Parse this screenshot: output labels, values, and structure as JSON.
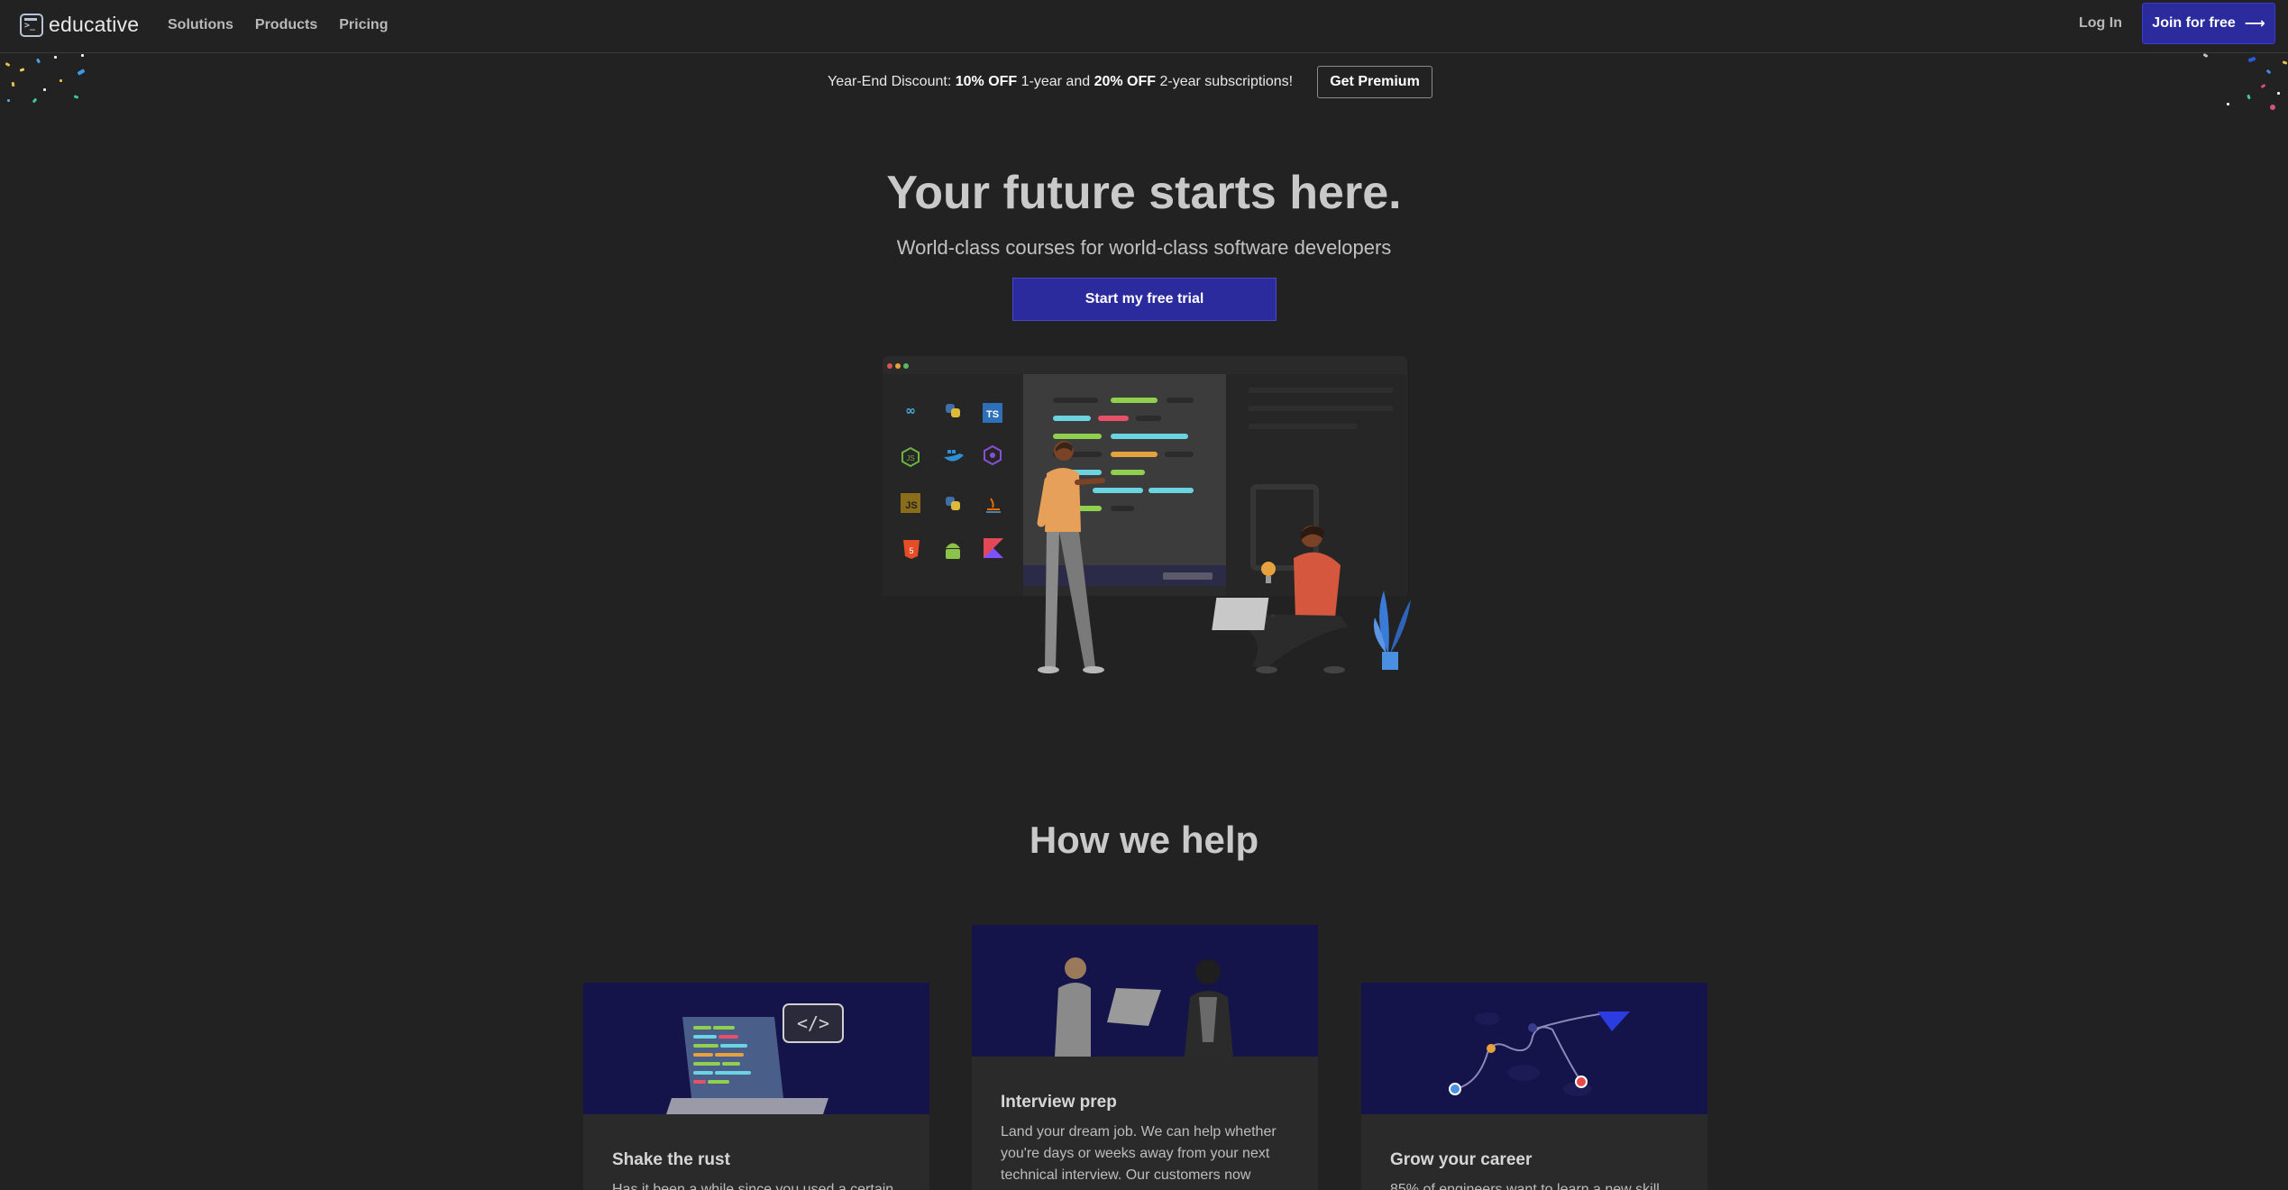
{
  "nav": {
    "logo_text": "educative",
    "links": [
      "Solutions",
      "Products",
      "Pricing"
    ],
    "login_label": "Log In",
    "join_label": "Join for free",
    "join_arrow": "⟶"
  },
  "promo": {
    "prefix": "Year-End Discount: ",
    "bold1": "10% OFF",
    "mid1": " 1-year and ",
    "bold2": "20% OFF",
    "suffix": " 2-year subscriptions!",
    "button_label": "Get Premium"
  },
  "hero": {
    "title": "Your future starts here.",
    "subtitle": "World-class courses for world-class software developers",
    "cta_label": "Start my free trial",
    "icon_labels": {
      "ts": "TS",
      "js": "JS"
    }
  },
  "how": {
    "title": "How we help",
    "cards": [
      {
        "title": "Shake the rust",
        "desc": "Has it been a while since you used a certain"
      },
      {
        "title": "Interview prep",
        "desc": "Land your dream job. We can help whether you're days or weeks away from your next technical interview. Our customers now"
      },
      {
        "title": "Grow your career",
        "desc": "85% of engineers want to learn a new skill"
      }
    ]
  },
  "colors": {
    "background": "#222222",
    "accent": "#2b2b9e",
    "card_image_bg": "#14134a"
  }
}
